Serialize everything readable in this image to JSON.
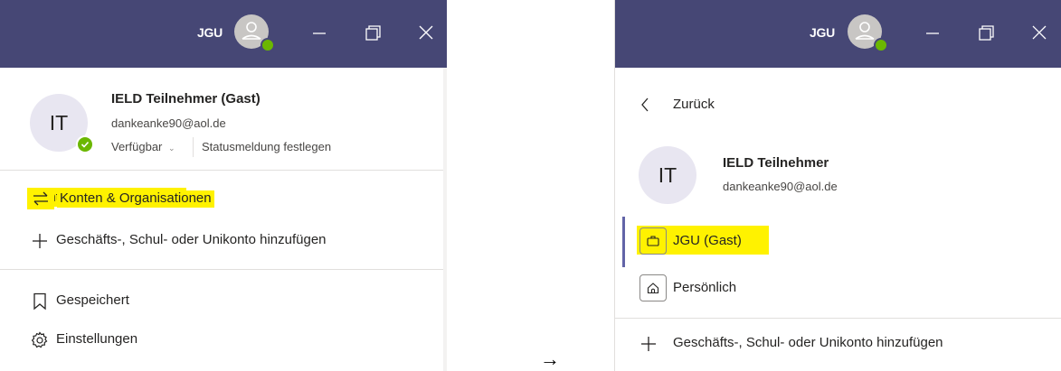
{
  "left": {
    "titlebar": {
      "org": "JGU"
    },
    "profile": {
      "initials": "IT",
      "name": "IELD Teilnehmer (Gast)",
      "email": "dankeanke90@aol.de",
      "availability": "Verfügbar",
      "status_message": "Statusmeldung festlegen"
    },
    "menu": {
      "accounts_orgs": "Konten & Organisationen",
      "add_account": "Geschäfts-, Schul- oder Unikonto hinzufügen",
      "saved": "Gespeichert",
      "settings": "Einstellungen"
    }
  },
  "separator": {
    "arrow": "→"
  },
  "right": {
    "titlebar": {
      "org": "JGU"
    },
    "back": "Zurück",
    "profile": {
      "initials": "IT",
      "name": "IELD Teilnehmer",
      "email": "dankeanke90@aol.de"
    },
    "orgs": [
      {
        "label": "JGU (Gast)",
        "icon": "briefcase-icon",
        "selected": true
      },
      {
        "label": "Persönlich",
        "icon": "home-icon",
        "selected": false
      }
    ],
    "add_account": "Geschäfts-, Schul- oder Unikonto hinzufügen"
  },
  "colors": {
    "titlebar": "#464775",
    "highlight": "#fff200",
    "available": "#6bb700",
    "accent": "#6264a7"
  }
}
